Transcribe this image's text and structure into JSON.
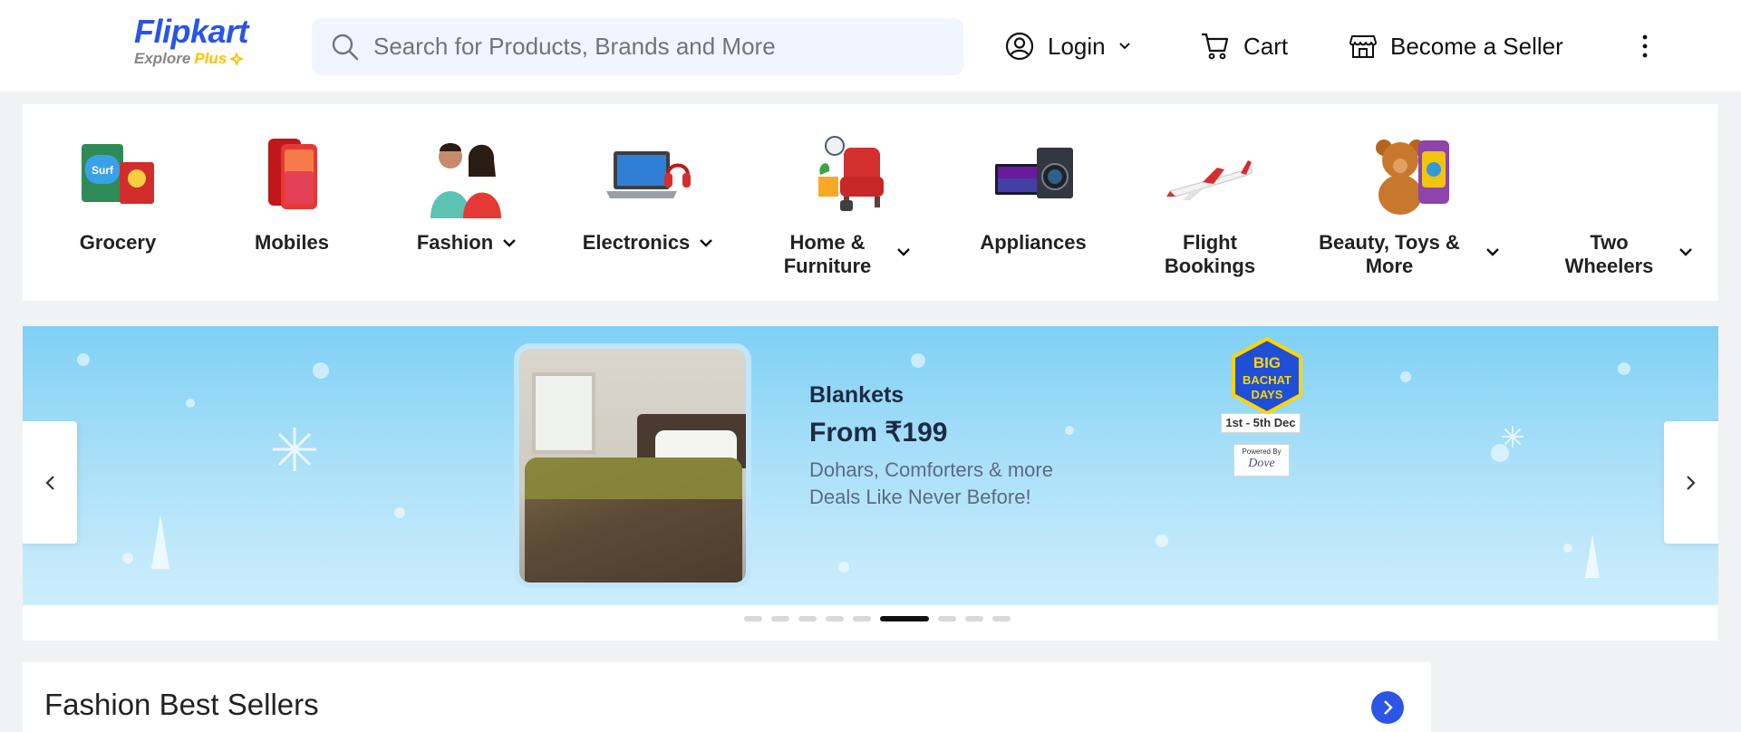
{
  "brand": {
    "name": "Flipkart",
    "tagline_prefix": "Explore",
    "tagline_plus": "Plus",
    "brand_color": "#2a55e5",
    "plus_color": "#ffc200"
  },
  "header": {
    "search": {
      "placeholder": "Search for Products, Brands and More",
      "value": "",
      "icon": "search-icon"
    },
    "login": {
      "label": "Login",
      "icon": "user-circle-icon"
    },
    "cart": {
      "label": "Cart",
      "icon": "cart-icon"
    },
    "seller": {
      "label": "Become a Seller",
      "icon": "store-icon"
    },
    "more": {
      "icon": "more-vertical-icon"
    }
  },
  "categories": [
    {
      "label": "Grocery",
      "has_dropdown": false,
      "icon": "grocery-icon"
    },
    {
      "label": "Mobiles",
      "has_dropdown": false,
      "icon": "mobile-icon"
    },
    {
      "label": "Fashion",
      "has_dropdown": true,
      "icon": "fashion-icon"
    },
    {
      "label": "Electronics",
      "has_dropdown": true,
      "icon": "laptop-icon"
    },
    {
      "label_line1": "Home &",
      "label_line2": "Furniture",
      "has_dropdown": true,
      "icon": "furniture-icon"
    },
    {
      "label": "Appliances",
      "has_dropdown": false,
      "icon": "appliance-icon"
    },
    {
      "label_line1": "Flight",
      "label_line2": "Bookings",
      "has_dropdown": false,
      "icon": "airplane-icon"
    },
    {
      "label_line1": "Beauty, Toys &",
      "label_line2": "More",
      "has_dropdown": true,
      "icon": "teddy-icon"
    },
    {
      "label_line1": "Two",
      "label_line2": "Wheelers",
      "has_dropdown": true,
      "icon": "scooter-icon"
    }
  ],
  "banner": {
    "title": "Blankets",
    "price": "From ₹199",
    "subtitle_line1": "Dohars, Comforters & more",
    "subtitle_line2": "Deals Like Never Before!",
    "badge_line1": "BIG",
    "badge_line2": "BACHAT",
    "badge_line3": "DAYS",
    "badge_dates": "1st - 5th Dec",
    "powered_by": "Powered By",
    "sponsor": "Dove",
    "slide_count": 9,
    "active_slide": 6
  },
  "section": {
    "title": "Fashion Best Sellers",
    "nav_icon": "chevron-right-icon"
  }
}
